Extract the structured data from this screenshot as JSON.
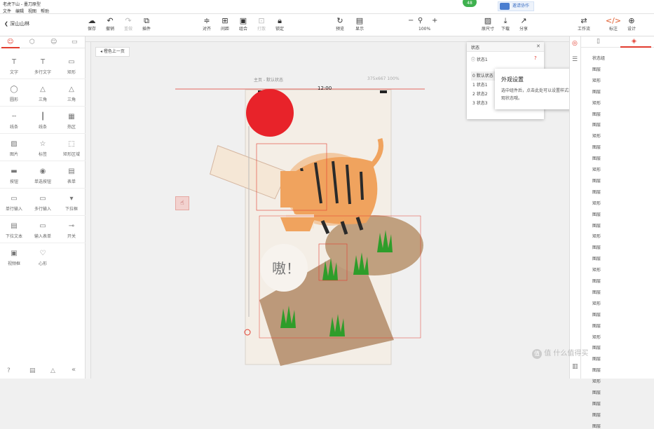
{
  "titlebar": {
    "title": "老虎下山 - 墨刀原型",
    "menu": [
      "文件",
      "编辑",
      "视图",
      "帮助"
    ],
    "notif_count": "48",
    "share_label": "邀请协作"
  },
  "project": {
    "name": "深山山林"
  },
  "toolbar": {
    "left": [
      {
        "label": "保存",
        "icon": "cloud-save"
      },
      {
        "label": "撤销",
        "icon": "undo"
      },
      {
        "label": "重做",
        "icon": "redo"
      },
      {
        "label": "插件",
        "icon": "plugin"
      }
    ],
    "center": [
      {
        "label": "对齐",
        "icon": "align"
      },
      {
        "label": "间距",
        "icon": "spacing"
      },
      {
        "label": "组合",
        "icon": "group"
      },
      {
        "label": "打散",
        "icon": "ungroup"
      },
      {
        "label": "锁定",
        "icon": "lock"
      }
    ],
    "right": [
      {
        "label": "预览",
        "icon": "preview"
      },
      {
        "label": "显示",
        "icon": "display"
      }
    ],
    "zoom": "100%",
    "far_right": [
      {
        "label": "原尺寸",
        "icon": "image"
      },
      {
        "label": "下载",
        "icon": "download"
      },
      {
        "label": "分享",
        "icon": "share"
      }
    ],
    "corner": [
      {
        "label": "工作流",
        "icon": "workflow"
      },
      {
        "label": "标注",
        "icon": "code"
      },
      {
        "label": "设计",
        "icon": "plus-circle"
      }
    ]
  },
  "components": [
    {
      "label": "文字",
      "icon": "T"
    },
    {
      "label": "多行文字",
      "icon": "T"
    },
    {
      "label": "矩形",
      "icon": "rect"
    },
    {
      "label": "圆形",
      "icon": "circle"
    },
    {
      "label": "三角",
      "icon": "triangle"
    },
    {
      "label": "三角",
      "icon": "triangle"
    },
    {
      "label": "线条",
      "icon": "line"
    },
    {
      "label": "线条",
      "icon": "vline"
    },
    {
      "label": "热区",
      "icon": "hotspot"
    },
    {
      "label": "图片",
      "icon": "image"
    },
    {
      "label": "标签",
      "icon": "star"
    },
    {
      "label": "矩形区域",
      "icon": "area"
    },
    {
      "label": "按钮",
      "icon": "button"
    },
    {
      "label": "单选按钮",
      "icon": "radio"
    },
    {
      "label": "表单",
      "icon": "form"
    },
    {
      "label": "单行输入",
      "icon": "input"
    },
    {
      "label": "多行输入",
      "icon": "textarea"
    },
    {
      "label": "下拉框",
      "icon": "select"
    },
    {
      "label": "下拉文本",
      "icon": "dropdown"
    },
    {
      "label": "输入表单",
      "icon": "form-input"
    },
    {
      "label": "开关",
      "icon": "switch"
    },
    {
      "label": "视频框",
      "icon": "video"
    },
    {
      "label": "心形",
      "icon": "heart"
    }
  ],
  "page_tab": "橙色上一页",
  "device": {
    "title": "主页 - 默认状态",
    "info": "375x667 100%",
    "time": "12:00"
  },
  "scene": {
    "bubble_text": "嗷！"
  },
  "states_panel": {
    "header": "状态",
    "current": "状态1",
    "items": [
      "0 默认状态",
      "1 状态1",
      "2 状态2",
      "3 状态3"
    ]
  },
  "popup": {
    "title": "外观设置",
    "body": "选中组件后，点击此处可以设置样式或是外观状态哦。"
  },
  "layers": [
    "状态组",
    "图层",
    "矩形",
    "图层",
    "矩形",
    "图层",
    "图层",
    "矩形",
    "图层",
    "图层",
    "矩形",
    "图层",
    "图层",
    "矩形",
    "图层",
    "图层",
    "矩形",
    "图层",
    "图层",
    "矩形",
    "图层",
    "图层",
    "矩形",
    "图层",
    "图层",
    "矩形",
    "图层",
    "图层",
    "图层",
    "矩形",
    "图层",
    "图层",
    "图层",
    "图层"
  ],
  "watermark": "值 什么值得买",
  "colors": {
    "accent": "#e23c2f",
    "sun": "#e8232a",
    "grass": "#2e9d2a",
    "ground": "#b89474",
    "tiger": "#f0a35e",
    "bg": "#f4eee6"
  }
}
